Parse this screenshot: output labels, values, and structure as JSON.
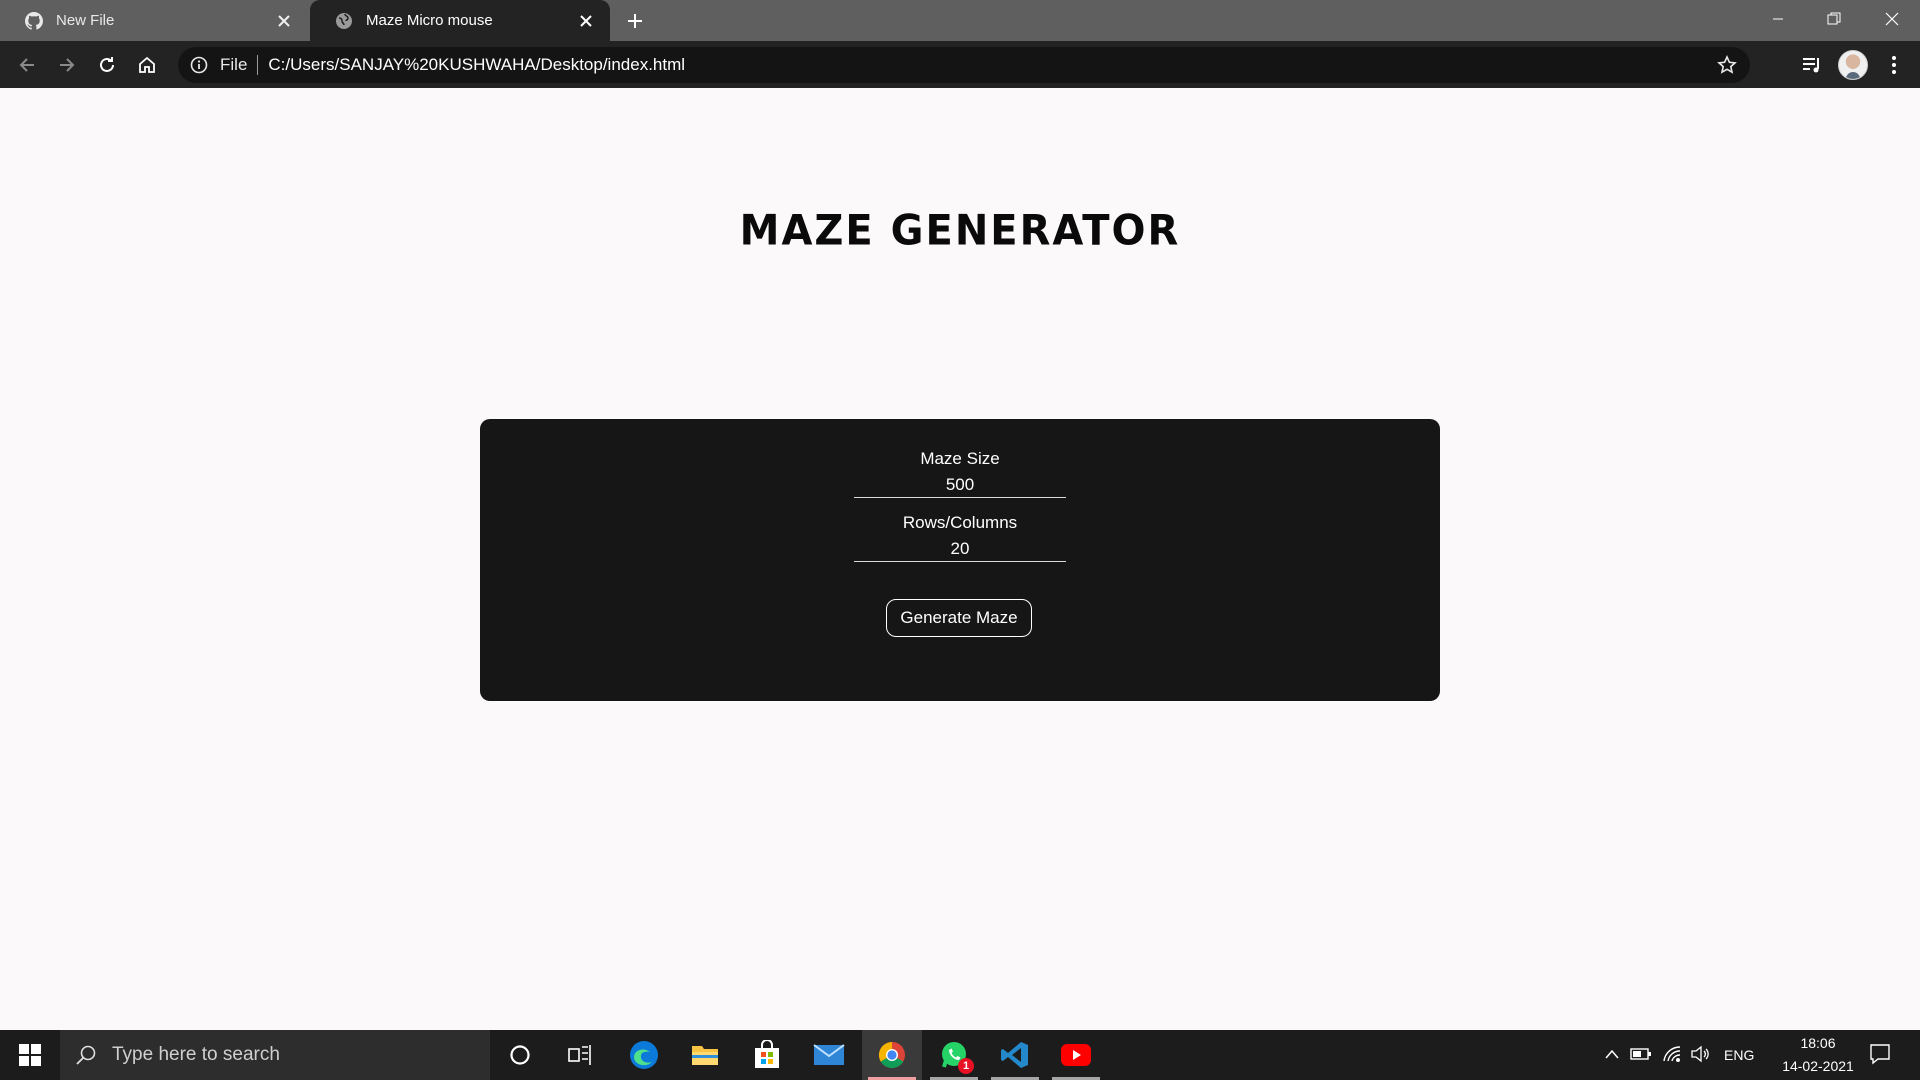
{
  "browser": {
    "tabs": [
      {
        "label": "New File",
        "favicon": "github-icon",
        "active": false
      },
      {
        "label": "Maze Micro mouse",
        "favicon": "globe-icon",
        "active": true
      }
    ],
    "address": {
      "scheme_label": "File",
      "url": "C:/Users/SANJAY%20KUSHWAHA/Desktop/index.html"
    }
  },
  "page": {
    "title": "Maze Generator",
    "form": {
      "maze_size_label": "Maze Size",
      "maze_size_value": "500",
      "rows_columns_label": "Rows/Columns",
      "rows_columns_value": "20",
      "generate_button": "Generate Maze"
    }
  },
  "taskbar": {
    "search_placeholder": "Type here to search",
    "pinned": [
      "cortana-icon",
      "task-view-icon",
      "edge-icon",
      "file-explorer-icon",
      "store-icon",
      "mail-icon",
      "chrome-icon",
      "whatsapp-icon",
      "vscode-icon",
      "youtube-icon"
    ],
    "whatsapp_badge": "1",
    "tray": {
      "language": "ENG",
      "time": "18:06",
      "date": "14-02-2021"
    }
  },
  "colors": {
    "page_bg": "#fbf9f9",
    "panel_bg": "#161616",
    "title": "#0a0a0a",
    "chrome_bg": "#232323",
    "tabstrip_bg": "#5f5f5f"
  }
}
